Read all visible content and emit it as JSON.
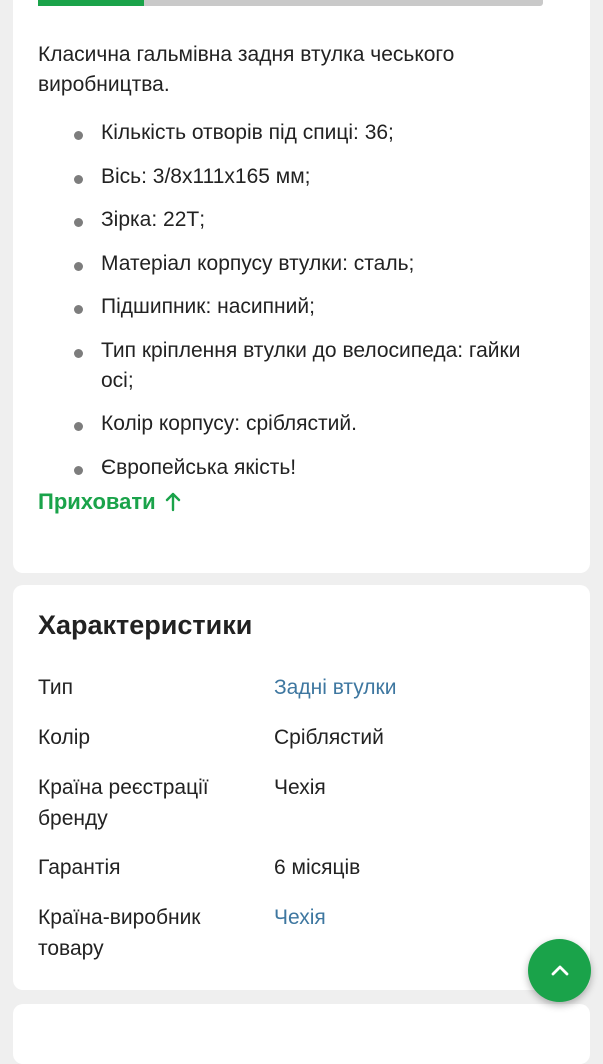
{
  "description": {
    "image_progress": 0.21,
    "intro": "Класична гальмівна задня втулка чеського виробництва.",
    "bullets": [
      "Кількість отворів під спиці: 36;",
      "Вісь: 3/8х111х165 мм;",
      "Зірка: 22Т;",
      "Матеріал корпусу втулки: сталь;",
      "Підшипник: насипний;",
      "Тип кріплення втулки до велосипеда: гайки осі;",
      "Колір корпусу: сріблястий.",
      "Європейська якість!"
    ],
    "hide_label": "Приховати",
    "hide_icon": "arrow-up-icon"
  },
  "specs": {
    "title": "Характеристики",
    "rows": [
      {
        "label": "Тип",
        "value": "Задні втулки",
        "is_link": true
      },
      {
        "label": "Колір",
        "value": "Сріблястий",
        "is_link": false
      },
      {
        "label": "Країна реєстрації бренду",
        "value": "Чехія",
        "is_link": false
      },
      {
        "label": "Гарантія",
        "value": "6 місяців",
        "is_link": false
      },
      {
        "label": "Країна-виробник товару",
        "value": "Чехія",
        "is_link": true
      }
    ]
  },
  "fab": {
    "icon": "chevron-up-icon"
  },
  "colors": {
    "accent": "#1aa34a",
    "link": "#3e77a0",
    "background": "#efefef"
  }
}
